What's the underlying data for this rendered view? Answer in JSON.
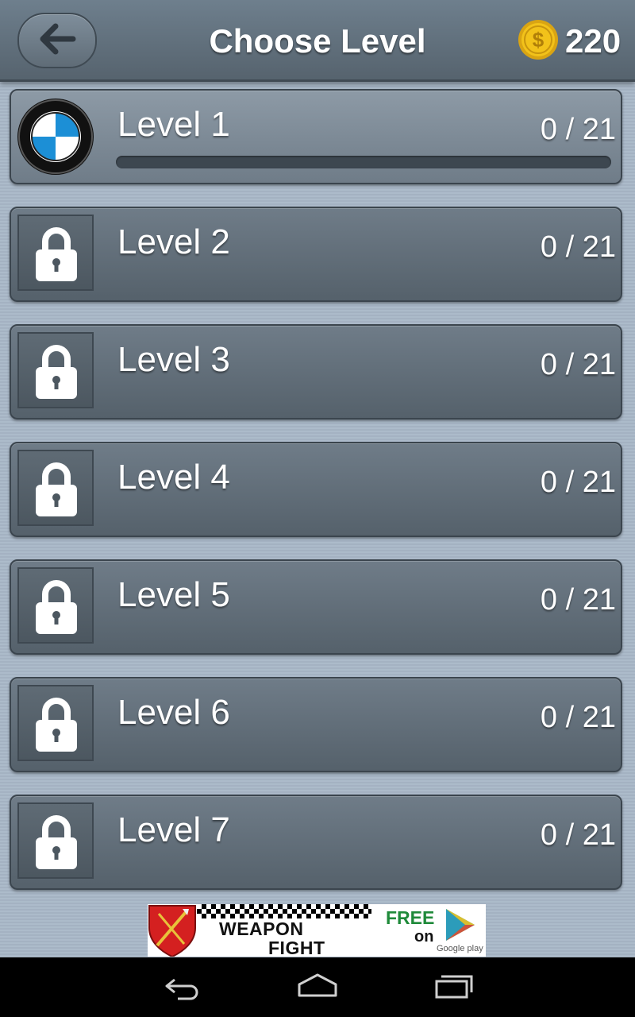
{
  "header": {
    "title": "Choose Level",
    "coins": "220",
    "back_icon": "arrow-left-icon",
    "coin_icon": "dollar-coin-icon"
  },
  "levels": [
    {
      "name": "Level 1",
      "score": "0 / 21",
      "locked": false,
      "icon": "bmw-logo",
      "progress": 0
    },
    {
      "name": "Level 2",
      "score": "0 / 21",
      "locked": true,
      "icon": "lock-icon"
    },
    {
      "name": "Level 3",
      "score": "0 / 21",
      "locked": true,
      "icon": "lock-icon"
    },
    {
      "name": "Level 4",
      "score": "0 / 21",
      "locked": true,
      "icon": "lock-icon"
    },
    {
      "name": "Level 5",
      "score": "0 / 21",
      "locked": true,
      "icon": "lock-icon"
    },
    {
      "name": "Level 6",
      "score": "0 / 21",
      "locked": true,
      "icon": "lock-icon"
    },
    {
      "name": "Level 7",
      "score": "0 / 21",
      "locked": true,
      "icon": "lock-icon"
    }
  ],
  "ad": {
    "line1": "WEAPON",
    "line2": "FIGHT",
    "free": "FREE",
    "on": "on",
    "store": "Google play"
  },
  "navbar": {
    "back_icon": "back-icon",
    "home_icon": "home-icon",
    "recents_icon": "recents-icon"
  },
  "colors": {
    "accent": "#6fb3e0",
    "coin": "#f2c21a",
    "ad_green": "#1f8a3a"
  }
}
